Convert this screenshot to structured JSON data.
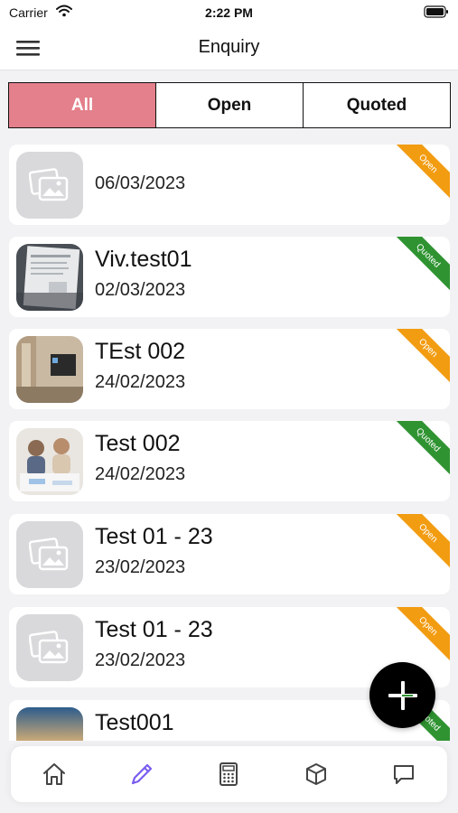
{
  "status_bar": {
    "carrier": "Carrier",
    "time": "2:22 PM"
  },
  "nav": {
    "title": "Enquiry",
    "menu_icon": "hamburger-menu-icon"
  },
  "segments": [
    {
      "label": "All",
      "active": true
    },
    {
      "label": "Open",
      "active": false
    },
    {
      "label": "Quoted",
      "active": false
    }
  ],
  "enquiries": [
    {
      "title": "",
      "date": "06/03/2023",
      "status": "Open",
      "thumbnail": "placeholder-image-icon"
    },
    {
      "title": "Viv.test01",
      "date": "02/03/2023",
      "status": "Quoted",
      "thumbnail": "document-photo"
    },
    {
      "title": "TEst 002",
      "date": "24/02/2023",
      "status": "Open",
      "thumbnail": "room-photo"
    },
    {
      "title": "Test 002",
      "date": "24/02/2023",
      "status": "Quoted",
      "thumbnail": "people-photo"
    },
    {
      "title": "Test 01 - 23",
      "date": "23/02/2023",
      "status": "Open",
      "thumbnail": "placeholder-image-icon"
    },
    {
      "title": "Test 01 - 23",
      "date": "23/02/2023",
      "status": "Open",
      "thumbnail": "placeholder-image-icon"
    },
    {
      "title": "Test001",
      "date": "",
      "status": "Quoted",
      "thumbnail": "sunset-photo"
    }
  ],
  "fab": {
    "icon": "plus-icon"
  },
  "tab_bar": [
    {
      "name": "home",
      "icon": "home-icon",
      "active": false
    },
    {
      "name": "enquiry",
      "icon": "pencil-icon",
      "active": true
    },
    {
      "name": "calculator",
      "icon": "calculator-icon",
      "active": false
    },
    {
      "name": "products",
      "icon": "box-icon",
      "active": false
    },
    {
      "name": "messages",
      "icon": "chat-bubble-icon",
      "active": false
    }
  ],
  "colors": {
    "segment_active": "#e3808b",
    "ribbon_open": "#f29c12",
    "ribbon_quoted": "#2f9331",
    "tab_active": "#7a5cf0",
    "tab_inactive": "#444444"
  }
}
